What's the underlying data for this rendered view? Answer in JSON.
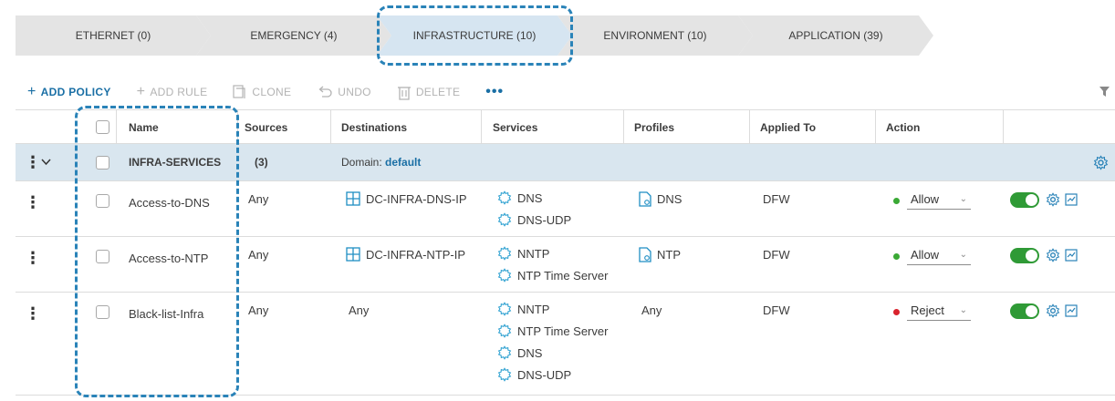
{
  "categories": [
    {
      "label": "ETHERNET (0)",
      "active": false
    },
    {
      "label": "EMERGENCY (4)",
      "active": false
    },
    {
      "label": "INFRASTRUCTURE (10)",
      "active": true
    },
    {
      "label": "ENVIRONMENT (10)",
      "active": false
    },
    {
      "label": "APPLICATION (39)",
      "active": false
    }
  ],
  "toolbar": {
    "add_policy": "ADD POLICY",
    "add_rule": "ADD RULE",
    "clone": "CLONE",
    "undo": "UNDO",
    "delete": "DELETE",
    "more": "•••"
  },
  "columns": {
    "name": "Name",
    "sources": "Sources",
    "destinations": "Destinations",
    "services": "Services",
    "profiles": "Profiles",
    "applied_to": "Applied To",
    "action": "Action"
  },
  "policy": {
    "name": "INFRA-SERVICES",
    "count": "(3)",
    "domain_label": "Domain:",
    "domain_value": "default"
  },
  "rules": [
    {
      "name": "Access-to-DNS",
      "sources": "Any",
      "destination": "DC-INFRA-DNS-IP",
      "services": [
        "DNS",
        "DNS-UDP"
      ],
      "profile": "DNS",
      "applied_to": "DFW",
      "action": "Allow",
      "action_color": "#3aa935",
      "enabled": true
    },
    {
      "name": "Access-to-NTP",
      "sources": "Any",
      "destination": "DC-INFRA-NTP-IP",
      "services": [
        "NNTP",
        "NTP Time Server"
      ],
      "profile": "NTP",
      "applied_to": "DFW",
      "action": "Allow",
      "action_color": "#3aa935",
      "enabled": true
    },
    {
      "name": "Black-list-Infra",
      "sources": "Any",
      "destination": "Any",
      "services": [
        "NNTP",
        "NTP Time Server",
        "DNS",
        "DNS-UDP"
      ],
      "profile": "Any",
      "applied_to": "DFW",
      "action": "Reject",
      "action_color": "#d9232d",
      "enabled": true
    }
  ],
  "colors": {
    "accent": "#1a6fa5",
    "highlight": "#2a83b8",
    "toggle_on": "#2f9a36",
    "group_row_bg": "#d9e6ef"
  }
}
